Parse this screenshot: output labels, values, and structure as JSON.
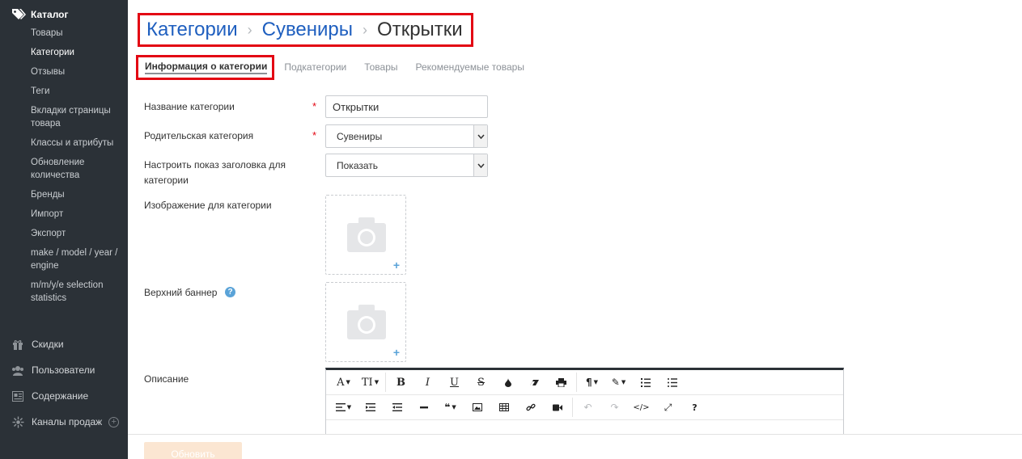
{
  "sidebar": {
    "section_title": "Каталог",
    "items": [
      {
        "label": "Товары"
      },
      {
        "label": "Категории"
      },
      {
        "label": "Отзывы"
      },
      {
        "label": "Теги"
      },
      {
        "label": "Вкладки страницы товара"
      },
      {
        "label": "Классы и атрибуты"
      },
      {
        "label": "Обновление количества"
      },
      {
        "label": "Бренды"
      },
      {
        "label": "Импорт"
      },
      {
        "label": "Экспорт"
      },
      {
        "label": "make / model / year / engine"
      },
      {
        "label": "m/m/y/e selection statistics"
      }
    ],
    "bottom": [
      {
        "label": "Скидки",
        "icon": "gift-icon"
      },
      {
        "label": "Пользователи",
        "icon": "users-icon"
      },
      {
        "label": "Содержание",
        "icon": "content-icon"
      },
      {
        "label": "Каналы продаж",
        "icon": "channels-icon"
      }
    ]
  },
  "breadcrumb": {
    "items": [
      "Категории",
      "Сувениры"
    ],
    "separator": "›",
    "current": "Открытки"
  },
  "tabs": [
    {
      "label": "Информация о категории"
    },
    {
      "label": "Подкатегории"
    },
    {
      "label": "Товары"
    },
    {
      "label": "Рекомендуемые товары"
    }
  ],
  "form": {
    "name_label": "Название категории",
    "name_value": "Открытки",
    "parent_label": "Родительская категория",
    "parent_value": "Сувениры",
    "title_display_label": "Настроить показ заголовка для категории",
    "title_display_value": "Показать",
    "image_label": "Изображение для категории",
    "banner_label": "Верхний баннер",
    "description_label": "Описание",
    "required_mark": "*",
    "help_mark": "?",
    "add_mark": "+"
  },
  "footer": {
    "save_label": "Обновить"
  },
  "colors": {
    "sidebar_bg": "#2b3137",
    "link": "#1f5fbf",
    "highlight_border": "#e30613",
    "accent_blue": "#5aa3d8",
    "save_button_bg": "#fbe6d2"
  }
}
